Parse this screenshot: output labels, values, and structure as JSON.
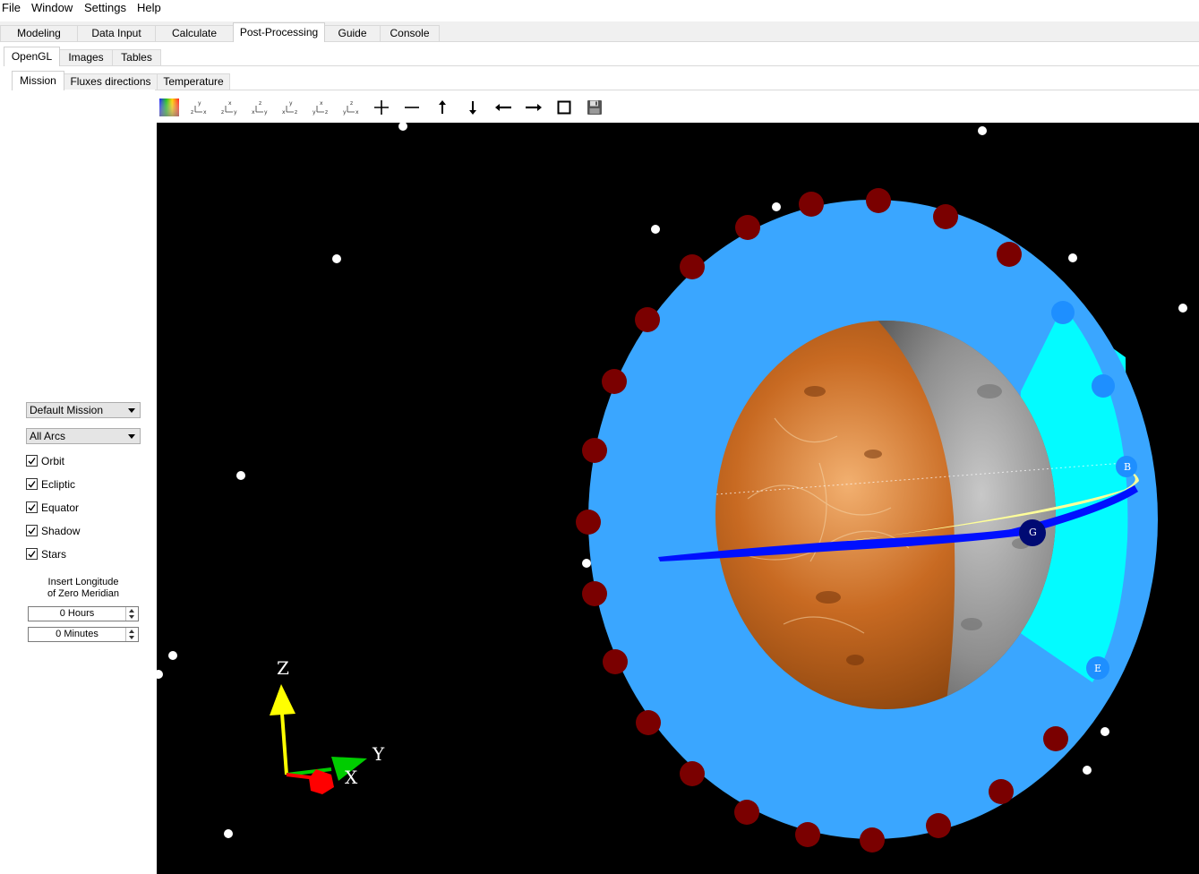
{
  "menubar": {
    "items": [
      "File",
      "Window",
      "Settings",
      "Help"
    ]
  },
  "main_tabs": [
    "Modeling",
    "Data Input",
    "Calculate",
    "Post-Processing",
    "Guide",
    "Console"
  ],
  "main_tabs_active": "Post-Processing",
  "sub_tabs": [
    "OpenGL",
    "Images",
    "Tables"
  ],
  "sub_tabs_active": "OpenGL",
  "view_tabs": [
    "Mission",
    "Fluxes directions",
    "Temperature"
  ],
  "view_tabs_active": "Mission",
  "sidebar": {
    "mission_select": "Default Mission",
    "arcs_select": "All Arcs",
    "checkboxes": [
      {
        "label": "Orbit",
        "checked": true
      },
      {
        "label": "Ecliptic",
        "checked": true
      },
      {
        "label": "Equator",
        "checked": true
      },
      {
        "label": "Shadow",
        "checked": true
      },
      {
        "label": "Stars",
        "checked": true
      }
    ],
    "insert_label_line1": "Insert Longitude",
    "insert_label_line2": "of Zero Meridian",
    "hours_value": "0 Hours",
    "minutes_value": "0 Minutes"
  },
  "toolbar": {
    "tools": [
      "color-scale-icon",
      "view-zx-icon",
      "view-zy-icon",
      "view-xy-icon",
      "view-xz-icon",
      "view-yz-icon",
      "view-yx-icon",
      "zoom-in-icon",
      "zoom-out-icon",
      "pan-up-icon",
      "pan-down-icon",
      "pan-left-icon",
      "pan-right-icon",
      "fit-view-icon",
      "save-icon"
    ]
  },
  "viewport": {
    "axis_labels": {
      "z": "Z",
      "y": "Y",
      "x": "X"
    },
    "markers": {
      "b": "B",
      "g": "G",
      "e": "E"
    },
    "colors": {
      "background": "#000000",
      "orbit_disc": "#3aa6ff",
      "shadow_cone": "#00ffff",
      "orbit_points": "#7a0000",
      "marker_blue": "#1e8fff",
      "marker_navy": "#000a73",
      "ecliptic_band": "#ffff99",
      "equator_band": "#0010ff",
      "axis_z": "#ffff00",
      "axis_y": "#00cc00",
      "axis_x": "#ff0000"
    }
  }
}
